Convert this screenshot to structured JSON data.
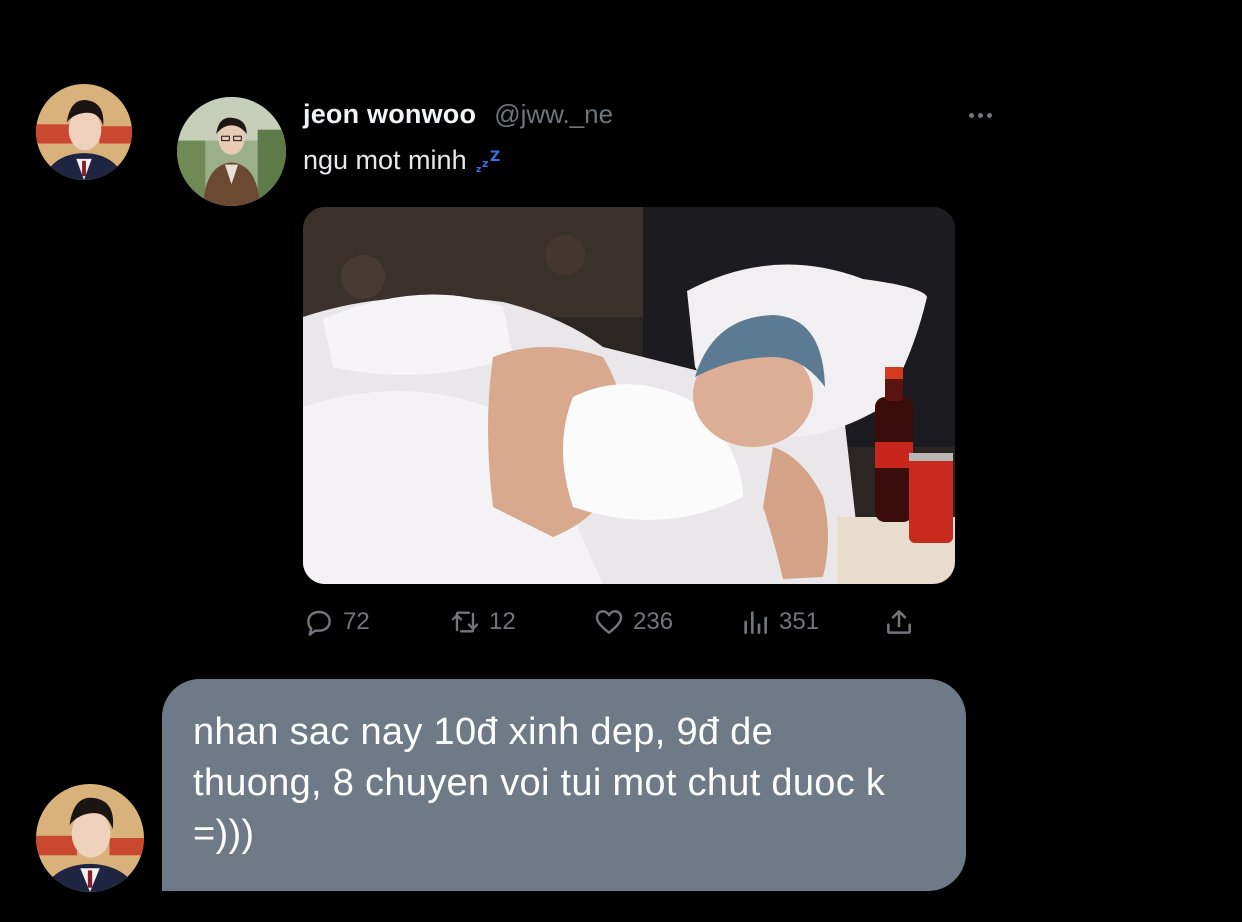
{
  "tweet": {
    "author_name": "jeon wonwoo",
    "author_handle": "@jww._ne",
    "text": "ngu mot minh",
    "emoji_icon": "zzz-icon",
    "media_alt": "photo",
    "stats": {
      "replies": "72",
      "retweets": "12",
      "likes": "236",
      "views": "351"
    }
  },
  "reply": {
    "text": "nhan sac nay 10đ xinh dep, 9đ de thuong, 8 chuyen voi tui mot chut duoc k =)))"
  },
  "colors": {
    "background": "#000000",
    "muted": "#71767b",
    "bubble": "#6e7a87",
    "zzz": "#3b6ee8"
  },
  "icons": [
    "reply-icon",
    "retweet-icon",
    "like-icon",
    "views-icon",
    "share-icon",
    "more-icon"
  ]
}
